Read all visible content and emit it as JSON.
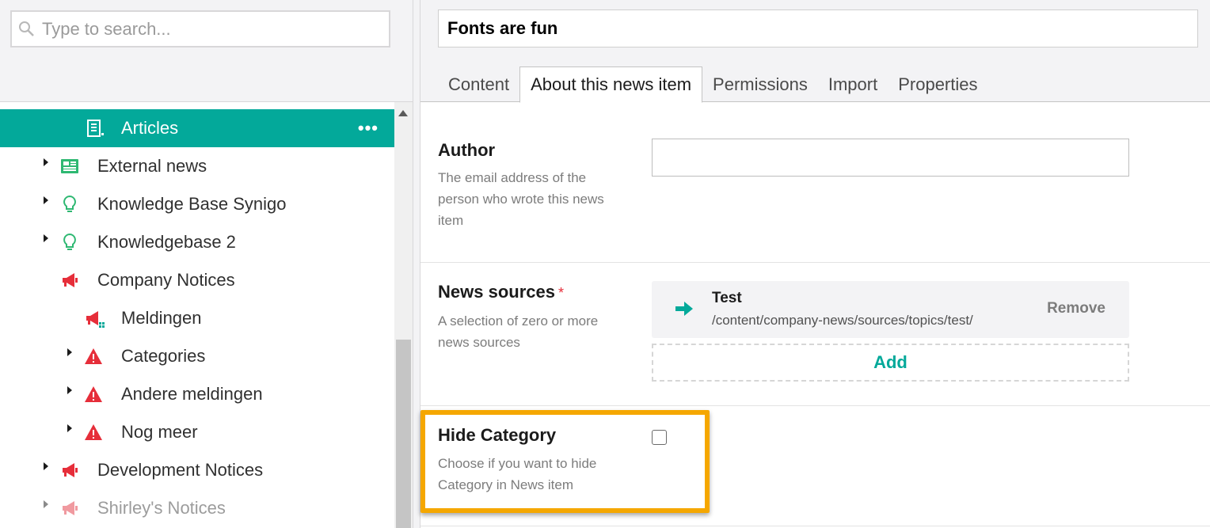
{
  "search": {
    "placeholder": "Type to search..."
  },
  "tree": {
    "items": [
      {
        "label": "Articles",
        "icon": "newspaper-file-icon",
        "active": true,
        "more": "•••"
      },
      {
        "label": "External news",
        "icon": "newspaper-icon"
      },
      {
        "label": "Knowledge Base Synigo",
        "icon": "lightbulb-icon"
      },
      {
        "label": "Knowledgebase 2",
        "icon": "lightbulb-icon"
      },
      {
        "label": "Company Notices",
        "icon": "megaphone-icon"
      },
      {
        "label": "Meldingen",
        "icon": "megaphone-grid-icon"
      },
      {
        "label": "Categories",
        "icon": "warning-icon"
      },
      {
        "label": "Andere meldingen",
        "icon": "warning-icon"
      },
      {
        "label": "Nog meer",
        "icon": "warning-icon"
      },
      {
        "label": "Development Notices",
        "icon": "megaphone-icon"
      },
      {
        "label": "Shirley's Notices",
        "icon": "megaphone-icon"
      }
    ]
  },
  "editor": {
    "title": "Fonts are fun",
    "tabs": [
      "Content",
      "About this news item",
      "Permissions",
      "Import",
      "Properties"
    ],
    "active_tab": "About this news item"
  },
  "fields": {
    "author": {
      "label": "Author",
      "desc": "The email address of the person who wrote this news item",
      "value": ""
    },
    "news_sources": {
      "label": "News sources",
      "required_mark": "*",
      "desc": "A selection of zero or more news sources",
      "item_title": "Test",
      "item_path": "/content/company-news/sources/topics/test/",
      "remove_label": "Remove",
      "add_label": "Add"
    },
    "hide_category": {
      "label": "Hide Category",
      "desc": "Choose if you want to hide Category in News item",
      "checked": false
    }
  },
  "colors": {
    "accent": "#03a99a",
    "highlight": "#f5a700",
    "danger": "#e62e3a"
  }
}
